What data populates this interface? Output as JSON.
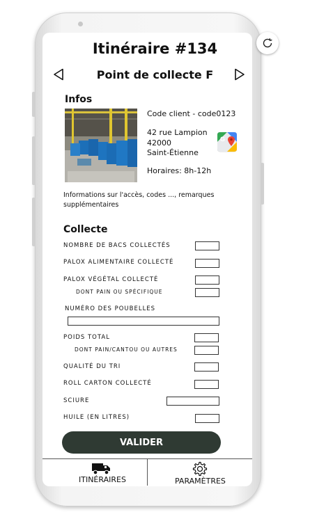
{
  "header": {
    "title": "Itinéraire #134",
    "collection_point": "Point de collecte F"
  },
  "infos": {
    "section_title": "Infos",
    "client_code": "Code client - code0123",
    "address_line1": "42 rue Lampion",
    "address_line2": "42000",
    "address_line3": "Saint-Étienne",
    "hours": "Horaires: 8h-12h",
    "notes": "Informations sur l'accès, codes ..., remarques supplémentaires"
  },
  "collecte": {
    "section_title": "Collecte",
    "fields": {
      "nb_bacs": "NOMBRE DE BACS COLLECTÉS",
      "palox_alimentaire": "PALOX ALIMENTAIRE COLLECTÉ",
      "palox_vegetal": "PALOX VÉGÉTAL COLLECTÉ",
      "dont_pain": "DONT PAIN OU SPÉCIFIQUE",
      "numero_poubelles": "NUMÉRO DES POUBELLES",
      "poids_total": "POIDS TOTAL",
      "dont_pain_cantou": "DONT PAIN/CANTOU OU AUTRES",
      "qualite_tri": "QUALITÉ DU TRI",
      "roll_carton": "ROLL CARTON COLLECTÉ",
      "sciure": "SCIURE",
      "huile": "HUILE (EN LITRES)"
    },
    "submit_label": "VALIDER"
  },
  "tabbar": {
    "itineraires_label": "ITINÉRAIRES",
    "parametres_label": "PARAMÈTRES"
  },
  "icons": {
    "rotate": "rotate-icon",
    "prev": "arrow-left-icon",
    "next": "arrow-right-icon",
    "maps": "google-maps-icon",
    "truck": "truck-icon",
    "gear": "gear-icon"
  },
  "colors": {
    "button_bg": "#2f3a33",
    "button_text": "#ffffff"
  }
}
